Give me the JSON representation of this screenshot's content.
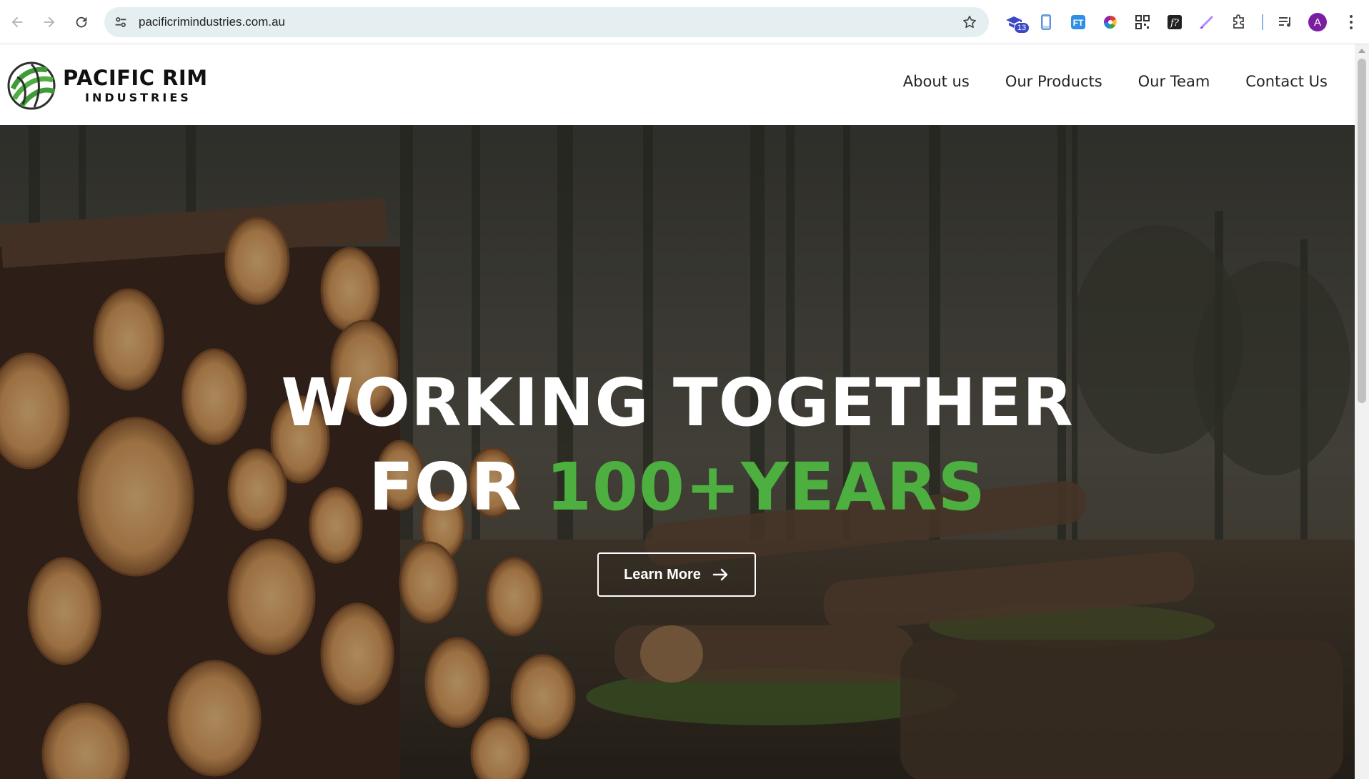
{
  "browser": {
    "url": "pacificrimindustries.com.au",
    "extension_badge": "13",
    "profile_initial": "A",
    "icons": [
      "back-icon",
      "forward-icon",
      "reload-icon",
      "site-settings-icon",
      "bookmark-star-icon",
      "graduation-cap-icon",
      "phone-icon",
      "translate-icon",
      "color-wheel-icon",
      "qr-code-icon",
      "function-icon",
      "pen-icon",
      "puzzle-icon",
      "playlist-icon",
      "more-vert-icon"
    ]
  },
  "site": {
    "logo": {
      "title": "PACIFIC RIM",
      "subtitle": "INDUSTRIES"
    },
    "nav": [
      {
        "label": "About us"
      },
      {
        "label": "Our Products"
      },
      {
        "label": "Our Team"
      },
      {
        "label": "Contact Us"
      }
    ]
  },
  "hero": {
    "line1": "WORKING TOGETHER",
    "line2_prefix": "FOR ",
    "line2_accent": "100+YEARS",
    "cta_label": "Learn More",
    "accent_color": "#4caf3f"
  }
}
